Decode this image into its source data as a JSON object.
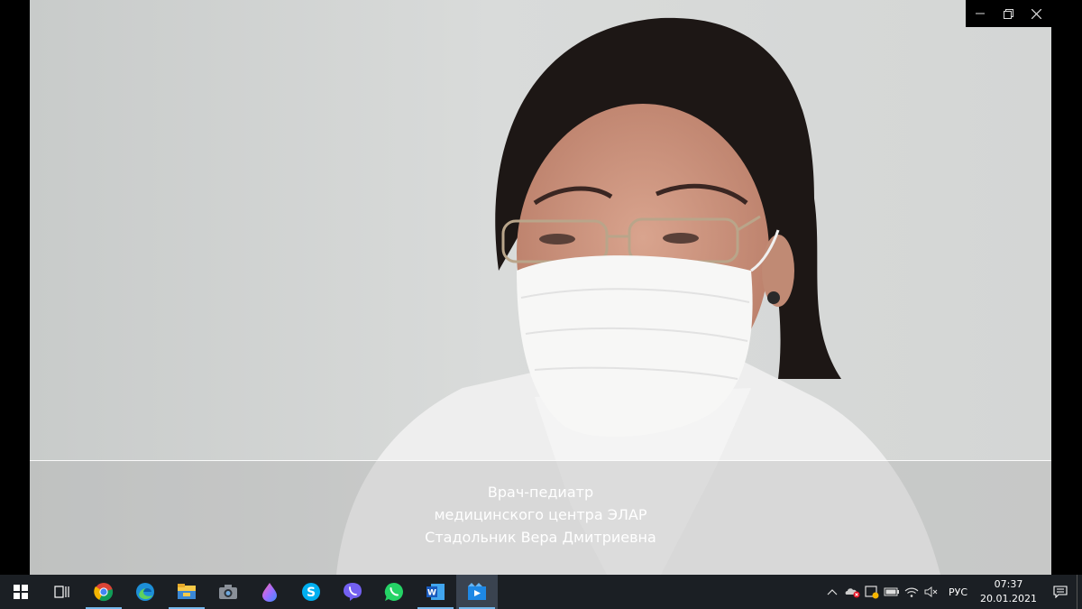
{
  "window": {
    "controls": {
      "minimize_icon": "minimize-icon",
      "restore_icon": "restore-icon",
      "close_icon": "close-icon"
    }
  },
  "video": {
    "caption": {
      "line1": "Врач-педиатр",
      "line2": "медицинского центра ЭЛАР",
      "line3": "Стадольник Вера Дмитриевна"
    }
  },
  "taskbar": {
    "apps": [
      {
        "icon": "windows-start-icon"
      },
      {
        "icon": "task-view-icon"
      },
      {
        "icon": "chrome-icon"
      },
      {
        "icon": "edge-icon"
      },
      {
        "icon": "file-explorer-icon"
      },
      {
        "icon": "camera-icon"
      },
      {
        "icon": "drop-app-icon"
      },
      {
        "icon": "skype-icon",
        "letter": "S"
      },
      {
        "icon": "viber-icon"
      },
      {
        "icon": "whatsapp-icon"
      },
      {
        "icon": "word-icon",
        "letter": "W"
      },
      {
        "icon": "movies-tv-icon"
      }
    ],
    "tray": {
      "language": "РУС",
      "time": "07:37",
      "date": "20.01.2021"
    }
  },
  "colors": {
    "taskbar_bg": "#1b1f24",
    "running_indicator": "#76b9ed",
    "caption_text": "#ffffff"
  }
}
